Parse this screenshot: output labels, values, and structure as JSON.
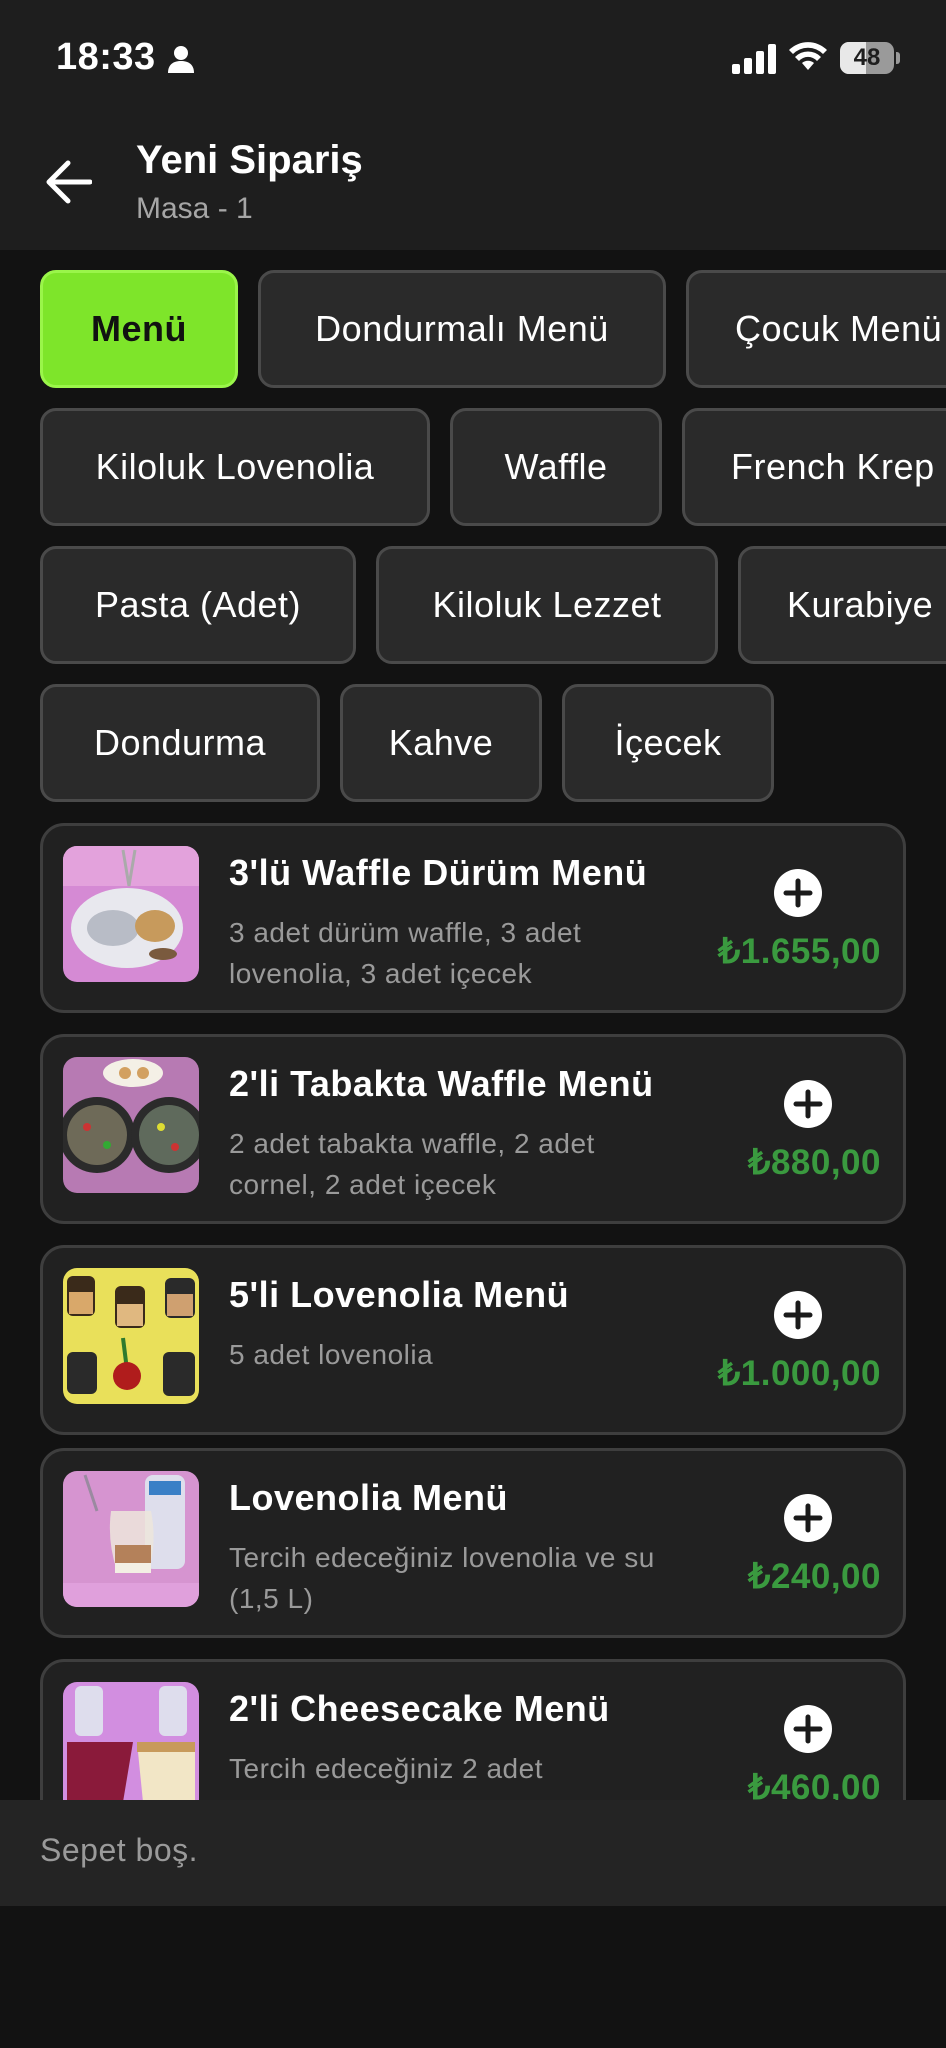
{
  "status_bar": {
    "time": "18:33",
    "battery": "48",
    "battery_level": 0.48,
    "icons": [
      "person-icon",
      "signal-icon",
      "wifi-icon",
      "battery-icon"
    ]
  },
  "app_bar": {
    "title": "Yeni Sipariş",
    "subtitle": "Masa - 1",
    "back_icon": "arrow-left-icon"
  },
  "categories": [
    "Menü",
    "Dondurmalı Menü",
    "Çocuk Menü",
    "Kiloluk Lovenolia",
    "Waffle",
    "French Krep",
    "Pasta (Adet)",
    "Kiloluk Lezzet",
    "Kurabiye",
    "Dondurma",
    "Kahve",
    "İçecek"
  ],
  "selected_category": "Menü",
  "menu_items": [
    {
      "title": "3'lü Waffle Dürüm Menü",
      "desc1": "3 adet dürüm waffle, 3 adet",
      "desc2": "lovenolia, 3 adet içecek",
      "price": "₺1.655,00"
    },
    {
      "title": "2'li Tabakta Waffle Menü",
      "desc1": "2 adet tabakta waffle, 2 adet",
      "desc2": "cornel, 2 adet içecek",
      "price": "₺880,00"
    },
    {
      "title": "5'li Lovenolia Menü",
      "desc1": "5 adet lovenolia",
      "desc2": "",
      "price": "₺1.000,00"
    },
    {
      "title": "Lovenolia Menü",
      "desc1": "Tercih edeceğiniz lovenolia ve su",
      "desc2": "(1,5 L)",
      "price": "₺240,00"
    },
    {
      "title": "2'li Cheesecake Menü",
      "desc1": "Tercih edeceğiniz 2 adet",
      "desc2": "",
      "price": "₺460,00"
    }
  ],
  "colors": {
    "accent": "#7ee52a",
    "price": "#3a9a3f",
    "background": "#121212",
    "surface": "#212121"
  },
  "cart": {
    "empty_text": "Sepet boş."
  }
}
